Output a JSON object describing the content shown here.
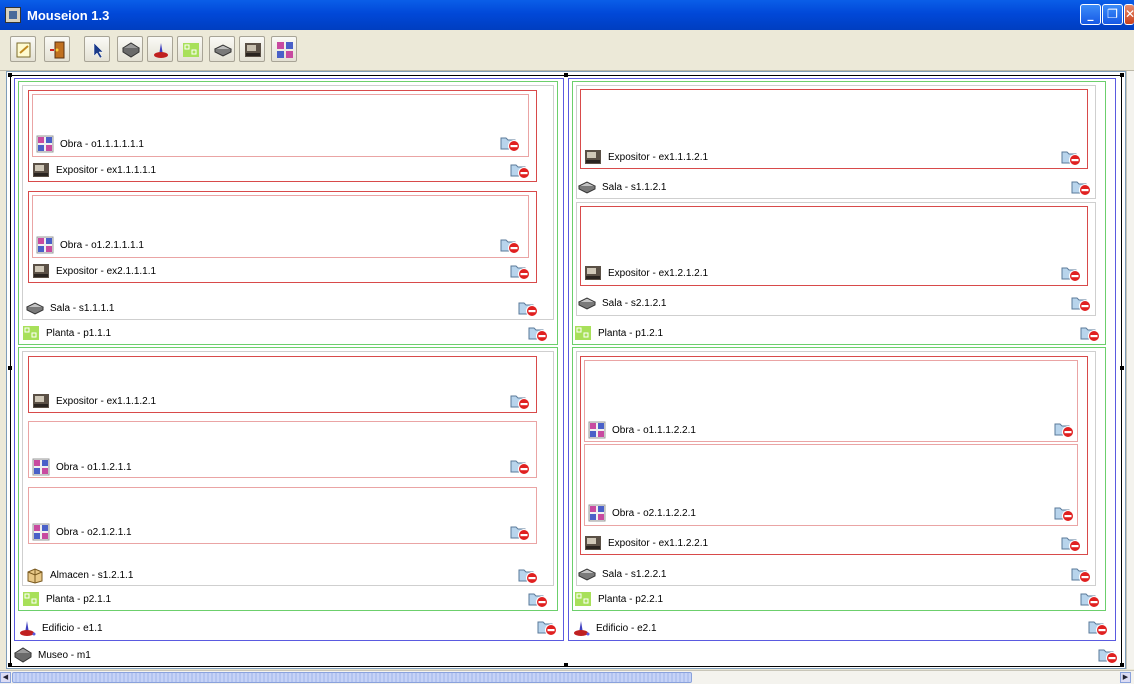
{
  "window": {
    "title": "Mouseion 1.3",
    "min_glyph": "_",
    "max_glyph": "❐",
    "close_glyph": "✕"
  },
  "toolbar": {
    "tools": [
      {
        "name": "new-document-icon"
      },
      {
        "name": "exit-door-icon"
      },
      {
        "name": "select-pointer-icon"
      },
      {
        "name": "museo-building-icon"
      },
      {
        "name": "edificio-icon"
      },
      {
        "name": "planta-floor-icon"
      },
      {
        "name": "sala-room-icon"
      },
      {
        "name": "expositor-showcase-icon"
      },
      {
        "name": "obra-artwork-icon"
      }
    ]
  },
  "diagram": {
    "museo": "Museo - m1",
    "edificio_1": "Edificio - e1.1",
    "edificio_2": "Edificio - e2.1",
    "p1_1": "Planta - p1.1.1",
    "p2_1": "Planta - p2.1.1",
    "p1_2": "Planta - p1.2.1",
    "p2_2": "Planta - p2.2.1",
    "s1_1_1": "Sala - s1.1.1.1",
    "s1_2_1": "Almacen - s1.2.1.1",
    "s1_1_2": "Sala - s1.1.2.1",
    "s2_1_2": "Sala - s2.1.2.1",
    "s1_2_2": "Sala - s1.2.2.1",
    "ex1_1_1_1": "Expositor - ex1.1.1.1.1",
    "ex2_1_1_1": "Expositor - ex2.1.1.1.1",
    "ex1_1_2_1": "Expositor - ex1.1.1.2.1",
    "ex1_1_1_2": "Expositor - ex1.1.1.2.1",
    "ex1_2_1_2": "Expositor - ex1.2.1.2.1",
    "ex1_1_2_2": "Expositor - ex1.1.2.2.1",
    "o1_1_1_1_1": "Obra - o1.1.1.1.1.1",
    "o1_2_1_1_1": "Obra - o1.2.1.1.1.1",
    "o1_1_2_1": "Obra - o1.1.2.1.1",
    "o2_1_2_1": "Obra - o2.1.2.1.1",
    "o1_1_1_2_2": "Obra - o1.1.1.2.2.1",
    "o2_1_1_2_2": "Obra - o2.1.1.2.2.1"
  },
  "colors": {
    "museo_border": "#000000",
    "edificio_border": "#5a5ae0",
    "planta_border": "#6ccf6c",
    "sala_border": "#cfcfcf",
    "expositor_border": "#d84a4a",
    "obra_border": "#eaa4a4"
  }
}
